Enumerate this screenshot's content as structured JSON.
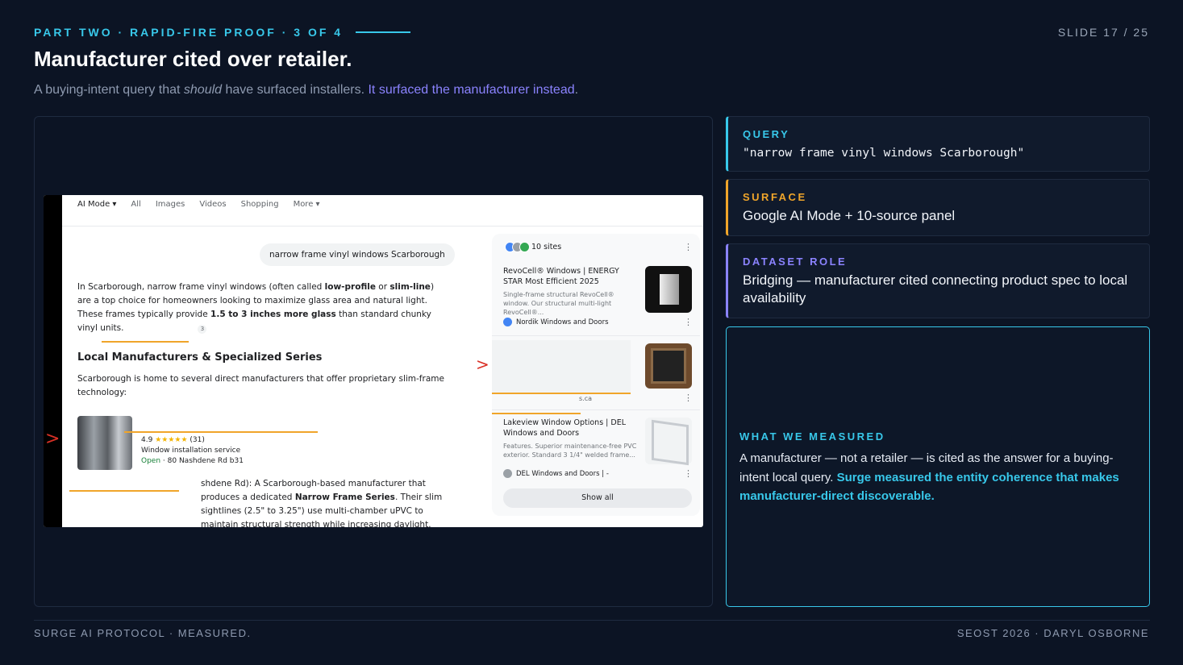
{
  "header": {
    "eyebrow": "PART TWO · RAPID-FIRE PROOF · 3 OF 4",
    "slide_number": "SLIDE 17 / 25",
    "title": "Manufacturer cited over retailer.",
    "subtitle_start": "A buying-intent query that ",
    "subtitle_em": "should",
    "subtitle_mid": " have surfaced installers. ",
    "subtitle_highlight": "It surfaced the manufacturer instead",
    "subtitle_end": "."
  },
  "screenshot": {
    "tabs": [
      "AI Mode ▾",
      "All",
      "Images",
      "Videos",
      "Shopping",
      "More ▾"
    ],
    "query_bubble": "narrow frame vinyl windows Scarborough",
    "para1_a": "In Scarborough, narrow frame vinyl windows (often called ",
    "para1_b": "low-profile",
    "para1_c": " or ",
    "para1_d": "slim-line",
    "para1_e": ") are a top choice for homeowners looking to maximize glass area and natural light. These frames typically provide ",
    "para1_f": "1.5 to 3 inches more glass",
    "para1_g": " than standard chunky vinyl units.",
    "para1_badge": "3",
    "heading": "Local Manufacturers & Specialized Series",
    "para2": "Scarborough is home to several direct manufacturers that offer proprietary slim-frame technology:",
    "local_rating": "4.9",
    "local_stars": "★★★★★",
    "local_count": "(31)",
    "local_type": "Window installation service",
    "local_open": "Open",
    "local_addr": " · 80 Nashdene Rd b31",
    "para3_a": "shdene Rd): A Scarborough-based manufacturer that produces a dedicated ",
    "para3_b": "Narrow Frame Series",
    "para3_c": ". Their slim sightlines (2.5\" to 3.25\") use multi-chamber uPVC to maintain structural strength while increasing daylight.",
    "panel": {
      "sites": "10 sites",
      "card1_title": "RevoCell® Windows | ENERGY STAR Most Efficient 2025",
      "card1_snip": "Single-frame structural RevoCell® window. Our structural multi-light RevoCell®...",
      "card1_src": "Nordik Windows and Doors",
      "card2_src": "s.ca",
      "card3_title": "Lakeview Window Options | DEL Windows and Doors",
      "card3_snip": "Features. Superior maintenance-free PVC exterior. Standard 3 1/4\" welded frame...",
      "card3_src": "DEL Windows and Doors | -",
      "show_all": "Show all",
      "kebab": "⋮"
    }
  },
  "cards": {
    "query_label": "QUERY",
    "query_value": "\"narrow frame vinyl windows Scarborough\"",
    "surface_label": "SURFACE",
    "surface_value": "Google AI Mode + 10-source panel",
    "role_label": "DATASET ROLE",
    "role_value": "Bridging — manufacturer cited connecting product spec to local availability",
    "measured_label": "WHAT WE MEASURED",
    "measured_text": "A manufacturer — not a retailer — is cited as the answer for a buying-intent local query. ",
    "measured_highlight": "Surge measured the entity coherence that makes manufacturer-direct discoverable."
  },
  "footer": {
    "left": "SURGE AI PROTOCOL · MEASURED.",
    "right": "SEOST 2026 · DARYL OSBORNE"
  },
  "colors": {
    "background": "#0c1424",
    "cyan": "#38c8ea",
    "orange": "#f0a52a",
    "violet": "#8b83ff"
  }
}
